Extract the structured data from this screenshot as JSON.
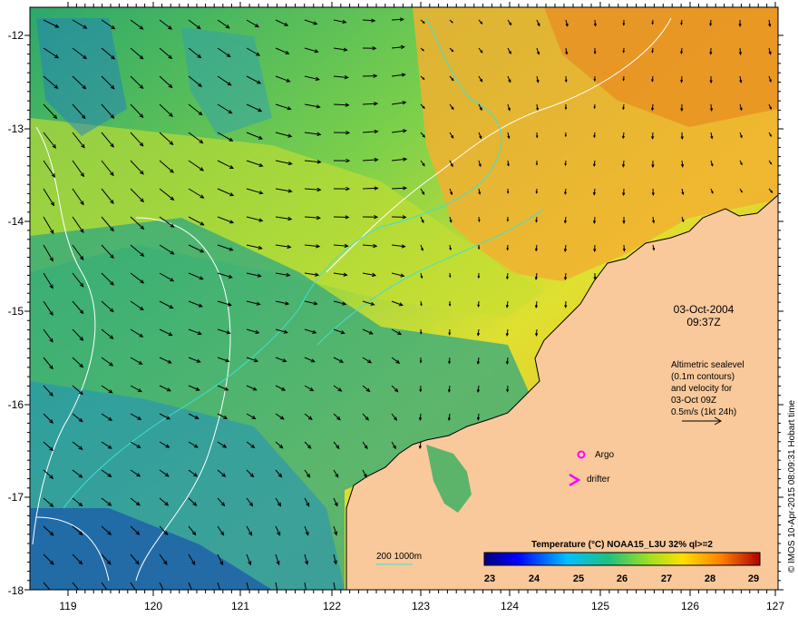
{
  "map": {
    "y_ticks": [
      "-12",
      "-13",
      "-14",
      "-15",
      "-16",
      "-17",
      "-18"
    ],
    "x_ticks": [
      "119",
      "120",
      "121",
      "122",
      "123",
      "124",
      "125",
      "126",
      "127"
    ],
    "date": "03-Oct-2004",
    "time": "09:37Z",
    "altimetry_note": [
      "Altimetric sealevel",
      "(0.1m contours)",
      "and velocity for",
      "03-Oct 09Z",
      "0.5m/s (1kt 24h)"
    ],
    "argo_label": "Argo",
    "drifter_label": "drifter",
    "depth_legend": "200  1000m",
    "colorbar_title": "Temperature (°C) NOAA15_L3U 32% ql>=2",
    "colorbar_ticks": [
      "23",
      "24",
      "25",
      "26",
      "27",
      "28",
      "29"
    ],
    "credit": "© IMOS 10-Apr-2015 08:09:31 Hobart time"
  },
  "colors": {
    "land": "#f9c99b",
    "argo_marker": "#ff00ff",
    "drifter_marker": "#ff00ff",
    "isobath": "#40e0d0",
    "sealevel_contour": "#ffffff"
  }
}
